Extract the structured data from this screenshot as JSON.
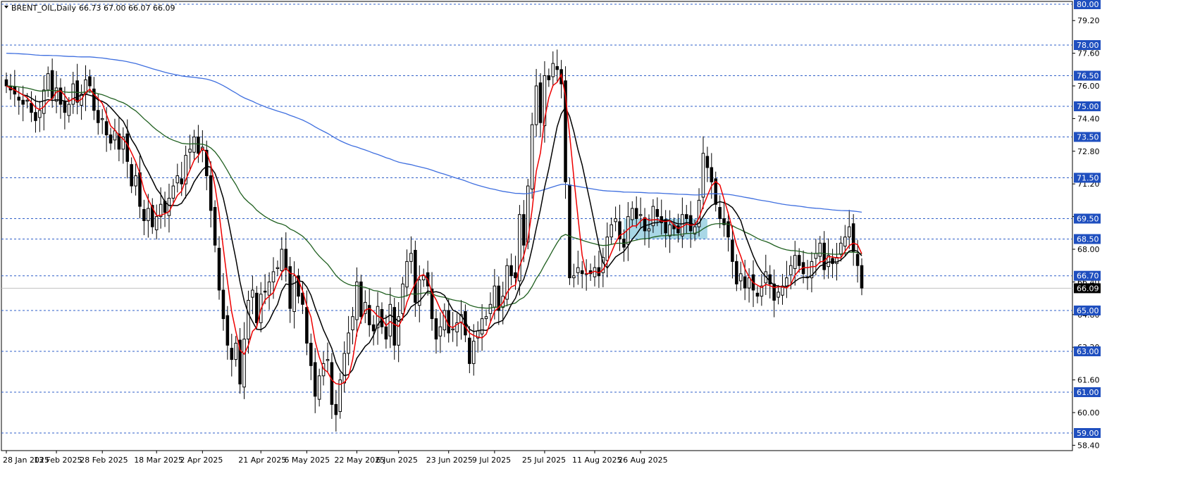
{
  "chart_data": {
    "type": "candlestick",
    "symbol_label": "BRENT_OIL,Daily",
    "ohlc_header": "66.73 67.00 66.07 66.09",
    "last_price": "66.09",
    "ylim": [
      58.0,
      80.0
    ],
    "y_ticks": [
      "79.20",
      "77.60",
      "76.00",
      "74.40",
      "72.80",
      "71.20",
      "69.60",
      "68.00",
      "66.40",
      "64.80",
      "63.20",
      "61.60",
      "60.00",
      "58.40"
    ],
    "x_labels": [
      "28 Jan 2025",
      "13 Feb 2025",
      "28 Feb 2025",
      "18 Mar 2025",
      "2 Apr 2025",
      "21 Apr 2025",
      "6 May 2025",
      "22 May 2025",
      "6 Jun 2025",
      "23 Jun 2025",
      "9 Jul 2025",
      "25 Jul 2025",
      "11 Aug 2025",
      "26 Aug 2025"
    ],
    "x_label_bar_index": [
      0,
      12,
      23,
      36,
      47,
      61,
      72,
      84,
      94,
      106,
      117,
      129,
      141,
      152
    ],
    "levels": [
      {
        "value": 80.0,
        "label": "80.00"
      },
      {
        "value": 78.0,
        "label": "78.00"
      },
      {
        "value": 76.5,
        "label": "76.50"
      },
      {
        "value": 75.0,
        "label": "75.00"
      },
      {
        "value": 73.5,
        "label": "73.50"
      },
      {
        "value": 71.5,
        "label": "71.50"
      },
      {
        "value": 69.5,
        "label": "69.50"
      },
      {
        "value": 68.5,
        "label": "68.50"
      },
      {
        "value": 66.7,
        "label": "66.70"
      },
      {
        "value": 65.0,
        "label": "65.00"
      },
      {
        "value": 63.0,
        "label": "63.00"
      },
      {
        "value": 61.0,
        "label": "61.00"
      },
      {
        "value": 59.0,
        "label": "59.00"
      }
    ],
    "zone": {
      "bar_start": 148,
      "bar_end": 168,
      "top": 69.5,
      "bottom": 68.5,
      "color": "#9fd3e3"
    },
    "colors": {
      "level_line": "#2f5fc8",
      "level_label_bg": "#1f4fbf",
      "ma_fast": "#ee0000",
      "ma_mid": "#000000",
      "ma_slow": "#1f5f1f",
      "ma_long": "#3f6fdf",
      "bull_fill": "#ffffff",
      "bear_fill": "#000000",
      "last_price_line": "#c0c0c0"
    },
    "series_close": [
      76.0,
      75.8,
      75.6,
      75.3,
      75.1,
      75.3,
      74.7,
      74.3,
      74.8,
      75.8,
      76.6,
      75.4,
      75.9,
      75.1,
      74.7,
      75.1,
      76.1,
      75.2,
      75.6,
      76.3,
      76.0,
      74.8,
      74.2,
      74.4,
      73.6,
      73.2,
      73.8,
      72.9,
      73.5,
      72.3,
      71.1,
      71.6,
      70.1,
      69.4,
      70.0,
      69.1,
      69.6,
      70.2,
      69.8,
      70.5,
      71.1,
      71.6,
      71.2,
      72.6,
      72.9,
      73.5,
      72.7,
      73.0,
      71.6,
      69.9,
      68.2,
      66.0,
      64.6,
      63.3,
      62.6,
      63.4,
      61.4,
      63.6,
      65.5,
      66.0,
      64.4,
      65.8,
      65.9,
      66.4,
      66.9,
      67.1,
      68.0,
      67.0,
      65.1,
      66.7,
      65.7,
      65.3,
      63.4,
      62.3,
      60.8,
      61.8,
      62.4,
      62.6,
      60.4,
      59.9,
      61.6,
      62.9,
      63.9,
      64.7,
      66.4,
      64.7,
      65.4,
      64.3,
      64.0,
      65.2,
      64.2,
      63.6,
      65.3,
      63.3,
      64.7,
      66.3,
      67.4,
      67.8,
      65.4,
      66.5,
      66.7,
      66.2,
      64.6,
      63.6,
      64.2,
      65.0,
      63.9,
      64.1,
      64.4,
      64.8,
      63.8,
      62.4,
      63.5,
      64.0,
      64.6,
      64.7,
      65.3,
      66.2,
      65.0,
      65.7,
      67.2,
      66.7,
      66.6,
      69.7,
      68.2,
      71.1,
      74.1,
      76.0,
      74.2,
      76.5,
      76.3,
      77.1,
      76.8,
      76.1,
      71.3,
      66.6,
      66.7,
      67.1,
      66.8,
      66.8,
      66.8,
      67.1,
      66.7,
      67.6,
      68.6,
      69.2,
      69.5,
      68.5,
      68.1,
      69.6,
      70.0,
      69.5,
      69.7,
      68.9,
      69.0,
      70.1,
      69.6,
      69.3,
      68.8,
      69.2,
      69.0,
      68.8,
      69.7,
      69.5,
      68.9,
      69.1,
      70.4,
      72.7,
      72.0,
      71.3,
      70.2,
      69.5,
      69.2,
      68.6,
      67.4,
      66.3,
      66.8,
      66.1,
      66.6,
      66.0,
      65.7,
      66.2,
      66.9,
      66.3,
      65.5,
      65.9,
      66.2,
      66.6,
      67.2,
      67.7,
      67.2,
      66.8,
      66.6,
      67.4,
      67.8,
      68.3,
      67.0,
      67.7,
      67.3,
      67.6,
      68.3,
      68.6,
      69.1,
      67.9,
      67.2,
      66.1
    ]
  }
}
